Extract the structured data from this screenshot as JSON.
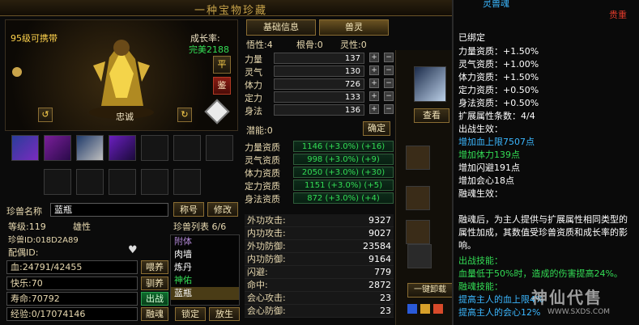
{
  "header": {
    "title": "一种宝物珍藏"
  },
  "pet": {
    "level_carry": "95级可携带",
    "growth_label": "成长率:",
    "growth_value": "完美2188",
    "name_tag": "忠诚",
    "btn_ping": "平",
    "btn_jian": "鉴"
  },
  "info": {
    "name_label": "珍兽名称",
    "name_value": "蓝瓶",
    "title_button": "称号",
    "modify_button": "修改",
    "level": "等级:119",
    "gender": "雄性",
    "pet_id": "珍兽ID:018D2A89",
    "mate": "配偶ID:",
    "list_header": "珍兽列表 6/6",
    "list_items": [
      "附体",
      "肉墙",
      "炼丹",
      "神佑",
      "蓝瓶"
    ],
    "hp": "血:24791/42455",
    "feed_button": "喂养",
    "happy": "快乐:70",
    "tame_button": "驯养",
    "life": "寿命:70792",
    "fight_button": "出战",
    "exp": "经验:0/17074146",
    "fuse_button": "融魂",
    "lock_button": "锁定",
    "release_button": "放生"
  },
  "tabs": {
    "basic": "基础信息",
    "spirit": "兽灵"
  },
  "attrs": {
    "wuxing": "悟性:4",
    "gengu": "根骨:0",
    "lingxing": "灵性:0",
    "rows": [
      {
        "label": "力量",
        "value": "137"
      },
      {
        "label": "灵气",
        "value": "130"
      },
      {
        "label": "体力",
        "value": "726"
      },
      {
        "label": "定力",
        "value": "133"
      },
      {
        "label": "身法",
        "value": "136"
      }
    ],
    "potential": "潜能:0",
    "confirm_button": "确定"
  },
  "aptitude": [
    {
      "label": "力量资质",
      "value": "1146 (+3.0%) (+16)"
    },
    {
      "label": "灵气资质",
      "value": "998 (+3.0%) (+9)"
    },
    {
      "label": "体力资质",
      "value": "2050 (+3.0%) (+30)"
    },
    {
      "label": "定力资质",
      "value": "1151 (+3.0%) (+5)"
    },
    {
      "label": "身法资质",
      "value": "872 (+3.0%) (+4)"
    }
  ],
  "combat": [
    {
      "label": "外功攻击:",
      "value": "9327"
    },
    {
      "label": "内功攻击:",
      "value": "9027"
    },
    {
      "label": "外功防御:",
      "value": "23584"
    },
    {
      "label": "内功防御:",
      "value": "9164"
    },
    {
      "label": "闪避:",
      "value": "779"
    },
    {
      "label": "命中:",
      "value": "2872"
    },
    {
      "label": "会心攻击:",
      "value": "23"
    },
    {
      "label": "会心防御:",
      "value": "23"
    }
  ],
  "mid": {
    "view_button": "查看",
    "unload_button": "一键卸载"
  },
  "tooltip": {
    "top_title": "灵兽魂",
    "rarity": "贵重",
    "bound": "已绑定",
    "bonuses": [
      "力量资质：+1.50%",
      "灵气资质：+1.00%",
      "体力资质：+1.50%",
      "定力资质：+0.50%",
      "身法资质：+0.50%"
    ],
    "count": "扩展属性条数：4/4",
    "effect_header": "出战生效：",
    "effect_lines": [
      "增加血上限7507点",
      "增加体力139点",
      "增加闪避191点",
      "增加会心18点"
    ],
    "fuse_header": "融魂生效：",
    "fuse_desc": "融魂后，为主人提供与扩展属性相同类型的属性加成，其数值受珍兽资质和成长率的影响。",
    "skill_header": "出战技能：",
    "skill_desc": "血量低于50%时，造成的伤害提高24%。",
    "fuse_skill_header": "融魂技能：",
    "fuse_skill_1": "提高主人的血上限4%",
    "fuse_skill_2": "提高主人的会心12%"
  },
  "watermark": {
    "brand": "神仙代售",
    "url": "WWW.SXDS.COM"
  },
  "colors": {
    "gold": "#ffd34d",
    "green": "#33dd55",
    "cyan": "#3bb7ff",
    "red": "#e03a2a"
  }
}
